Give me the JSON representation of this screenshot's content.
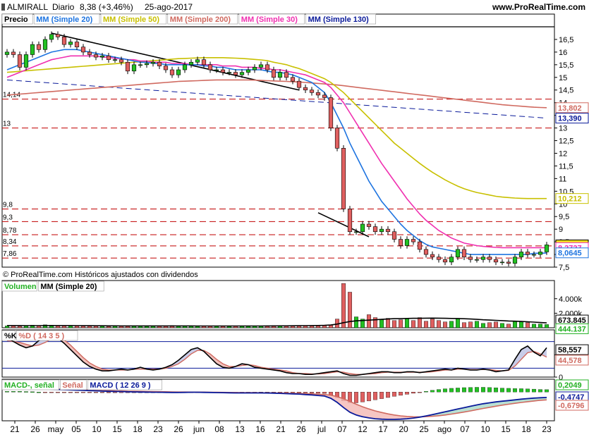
{
  "header": {
    "symbol": "ALMIRALL",
    "period": "Diario",
    "price_change": "8,38 (+3,46%)",
    "date": "25-ago-2017",
    "site": "www.ProRealTime.com"
  },
  "price_panel": {
    "legend": [
      {
        "label": "Precio",
        "color": "#000000"
      },
      {
        "label": "MM (Simple 20)",
        "color": "#1E74E0"
      },
      {
        "label": "MM (Simple 50)",
        "color": "#C8C000"
      },
      {
        "label": "MM (Simple 200)",
        "color": "#D06A60"
      },
      {
        "label": "MM (Simple 30)",
        "color": "#F030B0"
      },
      {
        "label": "MM (Simple 130)",
        "color": "#0A1A9A"
      }
    ],
    "footer": "© ProRealTime.com Históricos ajustados con dividendos",
    "y_ticks": [
      "16,5",
      "16",
      "15,5",
      "15",
      "14,5",
      "14",
      "13,5",
      "13",
      "12,5",
      "12",
      "11,5",
      "11",
      "10,5",
      "10",
      "9,5",
      "9",
      "8,5",
      "8",
      "7,5"
    ],
    "level_labels": [
      "14,14",
      "13",
      "9,8",
      "9,3",
      "8,78",
      "8,34",
      "7,86"
    ],
    "value_badges": [
      {
        "text": "13,802",
        "color": "#D06A60"
      },
      {
        "text": "13,390",
        "color": "#0A1A9A"
      },
      {
        "text": "10,212",
        "color": "#C8C000"
      },
      {
        "text": "8,38",
        "color": "#000000"
      },
      {
        "text": "8,2727",
        "color": "#F030B0"
      },
      {
        "text": "8,0645",
        "color": "#1E74E0"
      }
    ]
  },
  "volume_panel": {
    "legend": [
      {
        "label": "Volumen",
        "color": "#22B022"
      },
      {
        "label": "MM (Simple 20)",
        "color": "#000000"
      }
    ],
    "y_ticks": [
      "4.000k",
      "2.000k"
    ],
    "value_badges": [
      {
        "text": "673.845",
        "color": "#000000"
      },
      {
        "text": "444.137",
        "color": "#22B022"
      }
    ]
  },
  "stoch_panel": {
    "legend": [
      {
        "label": "%K",
        "color": "#000000"
      },
      {
        "label": "%D ( 14 3 5 )",
        "color": "#D06A60"
      }
    ],
    "y_ticks": [
      "50",
      "0"
    ],
    "value_badges": [
      {
        "text": "58,557",
        "color": "#000000"
      },
      {
        "text": "44,578",
        "color": "#D06A60"
      }
    ]
  },
  "macd_panel": {
    "legend": [
      {
        "label": "MACD-, señal",
        "color": "#22B022"
      },
      {
        "label": "Señal",
        "color": "#D06A60"
      },
      {
        "label": "MACD ( 12 26 9 )",
        "color": "#0A1A9A"
      }
    ],
    "value_badges": [
      {
        "text": "0,2049",
        "color": "#22B022"
      },
      {
        "text": "-0,4747",
        "color": "#0A1A9A"
      },
      {
        "text": "-0,6796",
        "color": "#D06A60"
      }
    ]
  },
  "x_axis": {
    "labels": [
      "21",
      "26",
      "may",
      "05",
      "10",
      "15",
      "18",
      "23",
      "26",
      "jun",
      "08",
      "13",
      "16",
      "21",
      "26",
      "jul",
      "07",
      "12",
      "17",
      "20",
      "25",
      "ago",
      "07",
      "10",
      "15",
      "18",
      "23"
    ]
  },
  "chart_data": {
    "type": "candlestick",
    "price_axis": {
      "min": 7.5,
      "max": 17.0
    },
    "hlines": [
      14.14,
      13.0,
      9.8,
      9.3,
      8.78,
      8.34,
      7.86
    ],
    "close": [
      16.0,
      15.9,
      15.4,
      15.9,
      16.3,
      16.1,
      16.5,
      16.7,
      16.6,
      16.3,
      16.4,
      16.2,
      16.0,
      15.9,
      15.8,
      15.85,
      15.7,
      15.7,
      15.6,
      15.25,
      15.5,
      15.5,
      15.55,
      15.6,
      15.45,
      15.3,
      15.1,
      15.3,
      15.5,
      15.6,
      15.7,
      15.5,
      15.3,
      15.3,
      15.2,
      15.2,
      15.1,
      15.2,
      15.3,
      15.4,
      15.5,
      15.3,
      15.0,
      15.2,
      15.0,
      14.85,
      14.6,
      14.5,
      14.4,
      14.3,
      14.2,
      13.0,
      12.2,
      9.8,
      8.9,
      8.9,
      9.2,
      9.1,
      8.9,
      9.0,
      8.9,
      8.6,
      8.35,
      8.6,
      8.5,
      8.2,
      8.0,
      7.9,
      7.8,
      7.7,
      7.9,
      8.2,
      7.9,
      7.8,
      7.8,
      7.9,
      7.8,
      7.7,
      7.7,
      7.65,
      7.9,
      8.1,
      8.0,
      8.0,
      8.1,
      8.38
    ],
    "sma20": [
      15.3,
      15.4,
      15.5,
      15.6,
      15.7,
      15.8,
      15.9,
      16.0,
      16.05,
      16.1,
      16.1,
      16.1,
      16.05,
      16.0,
      15.95,
      15.9,
      15.85,
      15.8,
      15.75,
      15.7,
      15.65,
      15.6,
      15.6,
      15.55,
      15.55,
      15.5,
      15.5,
      15.5,
      15.5,
      15.5,
      15.5,
      15.45,
      15.45,
      15.4,
      15.4,
      15.35,
      15.3,
      15.3,
      15.3,
      15.3,
      15.3,
      15.25,
      15.2,
      15.2,
      15.15,
      15.1,
      15.0,
      14.9,
      14.8,
      14.6,
      14.4,
      14.0,
      13.5,
      13.0,
      12.4,
      11.9,
      11.4,
      10.9,
      10.5,
      10.1,
      9.8,
      9.5,
      9.2,
      8.95,
      8.75,
      8.55,
      8.4,
      8.3,
      8.25,
      8.2,
      8.15,
      8.1,
      8.05,
      8.0,
      8.0,
      8.0,
      8.0,
      8.0,
      8.0,
      8.0,
      8.0,
      8.0,
      8.0,
      8.05,
      8.05,
      8.06
    ],
    "sma30": [
      15.0,
      15.1,
      15.2,
      15.3,
      15.4,
      15.5,
      15.6,
      15.7,
      15.75,
      15.8,
      15.85,
      15.85,
      15.85,
      15.85,
      15.85,
      15.8,
      15.8,
      15.75,
      15.75,
      15.7,
      15.7,
      15.65,
      15.65,
      15.6,
      15.6,
      15.6,
      15.55,
      15.55,
      15.55,
      15.5,
      15.5,
      15.5,
      15.5,
      15.5,
      15.45,
      15.45,
      15.45,
      15.4,
      15.4,
      15.4,
      15.35,
      15.35,
      15.3,
      15.3,
      15.25,
      15.2,
      15.15,
      15.1,
      15.0,
      14.9,
      14.8,
      14.6,
      14.3,
      14.0,
      13.6,
      13.2,
      12.8,
      12.4,
      12.0,
      11.6,
      11.25,
      10.9,
      10.55,
      10.2,
      9.9,
      9.6,
      9.35,
      9.15,
      8.95,
      8.8,
      8.65,
      8.55,
      8.45,
      8.4,
      8.35,
      8.32,
      8.3,
      8.28,
      8.27,
      8.27,
      8.27,
      8.27,
      8.27,
      8.27,
      8.27,
      8.27
    ],
    "sma50": [
      15.2,
      15.22,
      15.24,
      15.26,
      15.28,
      15.3,
      15.32,
      15.34,
      15.36,
      15.38,
      15.4,
      15.42,
      15.44,
      15.46,
      15.48,
      15.5,
      15.52,
      15.54,
      15.56,
      15.58,
      15.6,
      15.62,
      15.64,
      15.66,
      15.68,
      15.7,
      15.72,
      15.74,
      15.75,
      15.76,
      15.77,
      15.78,
      15.78,
      15.78,
      15.78,
      15.77,
      15.76,
      15.75,
      15.73,
      15.71,
      15.69,
      15.66,
      15.6,
      15.55,
      15.5,
      15.42,
      15.35,
      15.25,
      15.15,
      15.05,
      14.95,
      14.8,
      14.6,
      14.4,
      14.15,
      13.9,
      13.65,
      13.4,
      13.15,
      12.9,
      12.65,
      12.4,
      12.2,
      12.0,
      11.8,
      11.6,
      11.42,
      11.25,
      11.1,
      10.95,
      10.82,
      10.7,
      10.6,
      10.52,
      10.45,
      10.4,
      10.35,
      10.3,
      10.27,
      10.25,
      10.23,
      10.22,
      10.21,
      10.21,
      10.212,
      10.212
    ],
    "sma130": [
      14.9,
      14.94,
      14.98,
      15.02,
      15.06,
      15.1,
      15.14,
      15.18,
      15.22,
      15.25,
      15.28,
      15.3,
      15.32,
      15.34,
      15.36,
      15.38,
      15.4,
      15.42,
      15.44,
      15.46,
      15.48,
      15.5,
      15.52,
      15.54,
      15.56,
      15.58,
      15.6,
      15.62,
      15.64,
      15.66,
      15.68,
      15.7,
      15.72,
      15.74,
      15.76,
      15.78,
      15.8,
      15.8,
      15.8,
      15.78,
      15.75,
      15.72,
      15.68,
      15.64,
      15.6,
      15.55,
      15.5,
      15.45,
      15.4,
      15.35,
      15.3,
      15.25,
      15.2,
      15.15,
      15.1,
      15.05,
      15.0,
      14.95,
      14.9,
      14.85,
      14.8,
      14.75,
      14.7,
      14.65,
      14.6,
      14.55,
      14.5,
      14.45,
      14.4,
      14.35,
      14.3,
      14.25,
      14.2,
      14.15,
      14.1,
      14.05,
      14.0,
      13.95,
      13.9,
      13.85,
      13.8,
      13.7,
      13.6,
      13.5,
      13.45,
      13.39
    ],
    "sma200": [
      14.3,
      14.32,
      14.34,
      14.36,
      14.38,
      14.4,
      14.42,
      14.44,
      14.46,
      14.48,
      14.5,
      14.52,
      14.54,
      14.56,
      14.58,
      14.6,
      14.62,
      14.64,
      14.66,
      14.68,
      14.7,
      14.72,
      14.74,
      14.76,
      14.78,
      14.8,
      14.82,
      14.84,
      14.85,
      14.86,
      14.87,
      14.88,
      14.89,
      14.9,
      14.9,
      14.9,
      14.9,
      14.9,
      14.9,
      14.89,
      14.88,
      14.87,
      14.86,
      14.85,
      14.84,
      14.83,
      14.82,
      14.8,
      14.78,
      14.76,
      14.74,
      14.72,
      14.7,
      14.67,
      14.64,
      14.61,
      14.58,
      14.55,
      14.52,
      14.49,
      14.46,
      14.43,
      14.4,
      14.37,
      14.34,
      14.31,
      14.28,
      14.25,
      14.22,
      14.19,
      14.16,
      14.13,
      14.1,
      14.07,
      14.04,
      14.01,
      13.98,
      13.95,
      13.92,
      13.9,
      13.88,
      13.86,
      13.84,
      13.82,
      13.81,
      13.802
    ],
    "volume_k": [
      250,
      300,
      200,
      280,
      350,
      300,
      400,
      350,
      300,
      280,
      320,
      260,
      240,
      220,
      300,
      200,
      180,
      220,
      260,
      200,
      240,
      220,
      200,
      260,
      240,
      220,
      300,
      240,
      260,
      220,
      200,
      240,
      220,
      260,
      200,
      180,
      220,
      240,
      200,
      220,
      260,
      240,
      300,
      280,
      260,
      320,
      300,
      280,
      260,
      300,
      350,
      400,
      1200,
      6100,
      4900,
      1500,
      1200,
      1800,
      1400,
      1100,
      1300,
      1000,
      1100,
      1300,
      1000,
      1400,
      900,
      1200,
      1000,
      800,
      900,
      1300,
      700,
      800,
      900,
      600,
      700,
      800,
      600,
      500,
      900,
      800,
      700,
      500,
      500,
      444
    ],
    "volume_sma_k": [
      300,
      300,
      300,
      290,
      290,
      290,
      300,
      300,
      300,
      300,
      300,
      290,
      280,
      280,
      270,
      270,
      260,
      260,
      250,
      250,
      250,
      250,
      250,
      250,
      250,
      250,
      250,
      250,
      250,
      250,
      240,
      240,
      240,
      240,
      240,
      240,
      240,
      240,
      240,
      240,
      240,
      250,
      250,
      260,
      260,
      270,
      280,
      290,
      300,
      310,
      330,
      380,
      500,
      700,
      850,
      950,
      1000,
      1050,
      1100,
      1150,
      1200,
      1250,
      1250,
      1280,
      1300,
      1300,
      1320,
      1330,
      1320,
      1300,
      1280,
      1270,
      1240,
      1200,
      1150,
      1100,
      1060,
      1020,
      980,
      930,
      900,
      860,
      820,
      780,
      720,
      674
    ],
    "stoch_k": [
      88,
      80,
      72,
      66,
      70,
      82,
      90,
      94,
      88,
      76,
      62,
      48,
      34,
      24,
      18,
      14,
      14,
      16,
      18,
      16,
      18,
      22,
      18,
      16,
      18,
      22,
      28,
      38,
      50,
      62,
      66,
      58,
      44,
      30,
      22,
      20,
      24,
      30,
      28,
      22,
      20,
      18,
      16,
      14,
      10,
      8,
      8,
      6,
      6,
      8,
      10,
      12,
      14,
      8,
      4,
      4,
      6,
      8,
      10,
      12,
      12,
      10,
      10,
      12,
      12,
      10,
      12,
      14,
      16,
      18,
      16,
      20,
      18,
      16,
      16,
      18,
      16,
      12,
      14,
      16,
      40,
      62,
      70,
      56,
      48,
      66
    ],
    "stoch_d": [
      82,
      80,
      78,
      74,
      70,
      72,
      78,
      86,
      90,
      84,
      72,
      58,
      44,
      32,
      24,
      18,
      16,
      16,
      16,
      16,
      18,
      18,
      18,
      18,
      18,
      20,
      24,
      30,
      40,
      52,
      60,
      60,
      52,
      40,
      30,
      24,
      24,
      26,
      28,
      26,
      22,
      20,
      18,
      16,
      14,
      10,
      8,
      8,
      7,
      7,
      8,
      10,
      12,
      11,
      8,
      6,
      6,
      7,
      8,
      10,
      11,
      11,
      11,
      11,
      11,
      11,
      11,
      12,
      14,
      16,
      16,
      18,
      18,
      17,
      17,
      17,
      17,
      15,
      14,
      15,
      25,
      40,
      55,
      58,
      52,
      45
    ],
    "macd": [
      0.3,
      0.32,
      0.33,
      0.32,
      0.3,
      0.28,
      0.26,
      0.24,
      0.22,
      0.2,
      0.18,
      0.16,
      0.14,
      0.12,
      0.1,
      0.08,
      0.06,
      0.05,
      0.04,
      0.02,
      0.01,
      0.0,
      -0.01,
      -0.02,
      -0.02,
      -0.03,
      -0.04,
      -0.04,
      -0.03,
      -0.02,
      -0.02,
      -0.03,
      -0.04,
      -0.05,
      -0.06,
      -0.07,
      -0.08,
      -0.08,
      -0.08,
      -0.08,
      -0.08,
      -0.09,
      -0.1,
      -0.12,
      -0.14,
      -0.16,
      -0.18,
      -0.22,
      -0.25,
      -0.3,
      -0.35,
      -0.55,
      -0.9,
      -1.35,
      -1.75,
      -2.0,
      -2.15,
      -2.25,
      -2.32,
      -2.36,
      -2.38,
      -2.38,
      -2.36,
      -2.32,
      -2.26,
      -2.18,
      -2.08,
      -1.96,
      -1.84,
      -1.72,
      -1.6,
      -1.48,
      -1.36,
      -1.24,
      -1.12,
      -1.02,
      -0.94,
      -0.86,
      -0.8,
      -0.74,
      -0.68,
      -0.62,
      -0.57,
      -0.53,
      -0.5,
      -0.4747
    ],
    "macd_signal": [
      0.25,
      0.26,
      0.27,
      0.28,
      0.28,
      0.28,
      0.27,
      0.26,
      0.25,
      0.24,
      0.22,
      0.21,
      0.19,
      0.18,
      0.16,
      0.14,
      0.13,
      0.11,
      0.1,
      0.08,
      0.07,
      0.06,
      0.05,
      0.04,
      0.03,
      0.02,
      0.01,
      0.0,
      0.0,
      -0.01,
      -0.01,
      -0.01,
      -0.02,
      -0.02,
      -0.03,
      -0.04,
      -0.04,
      -0.05,
      -0.06,
      -0.06,
      -0.07,
      -0.07,
      -0.08,
      -0.09,
      -0.1,
      -0.11,
      -0.12,
      -0.14,
      -0.16,
      -0.19,
      -0.22,
      -0.28,
      -0.4,
      -0.59,
      -0.82,
      -1.06,
      -1.28,
      -1.47,
      -1.64,
      -1.78,
      -1.9,
      -2.0,
      -2.07,
      -2.12,
      -2.15,
      -2.16,
      -2.14,
      -2.11,
      -2.06,
      -2.0,
      -1.92,
      -1.83,
      -1.74,
      -1.64,
      -1.53,
      -1.43,
      -1.33,
      -1.23,
      -1.14,
      -1.06,
      -0.98,
      -0.91,
      -0.84,
      -0.78,
      -0.72,
      -0.6796
    ]
  }
}
